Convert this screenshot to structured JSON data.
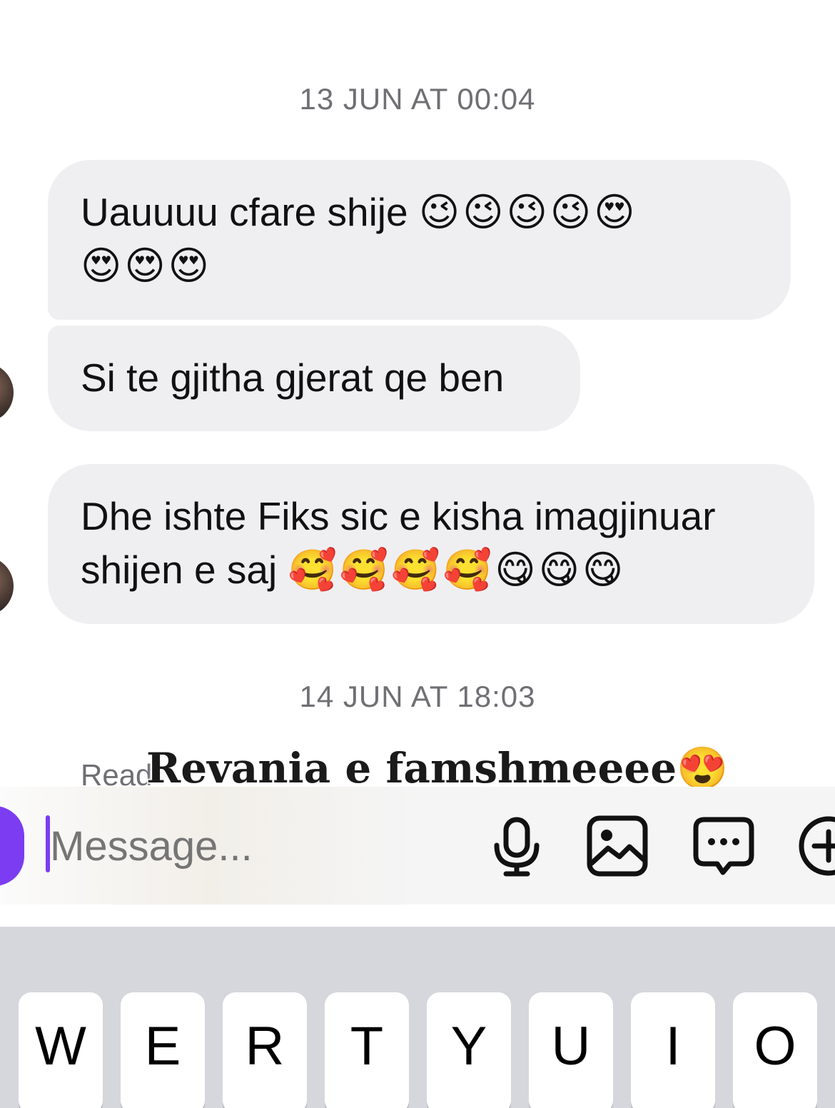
{
  "thread": {
    "timestamp_1": "13 JUN AT 00:04",
    "timestamp_2": "14 JUN AT 18:03",
    "messages": [
      {
        "text": "Uauuuu cfare shije",
        "emoji_line_1": "😉😉😉😉😍",
        "emoji_line_2": "😍😍😍"
      },
      {
        "text": "Si te gjitha gjerat qe ben"
      },
      {
        "text_line_1": "Dhe ishte Fiks sic e kisha imagjinuar",
        "text_line_2": "shijen e saj",
        "emojis": "🥰🥰🥰🥰😋😋😋"
      }
    ],
    "read_receipt": "Read",
    "overlay_caption": "Revania e famshmeeee😍"
  },
  "composer": {
    "placeholder": "Message...",
    "icons": [
      "camera-icon",
      "microphone-icon",
      "gallery-icon",
      "sticker-chat-icon",
      "plus-icon"
    ],
    "accent_color": "#7b3cf2"
  },
  "keyboard": {
    "keys": [
      "W",
      "E",
      "R",
      "T",
      "Y",
      "U",
      "I",
      "O"
    ]
  }
}
